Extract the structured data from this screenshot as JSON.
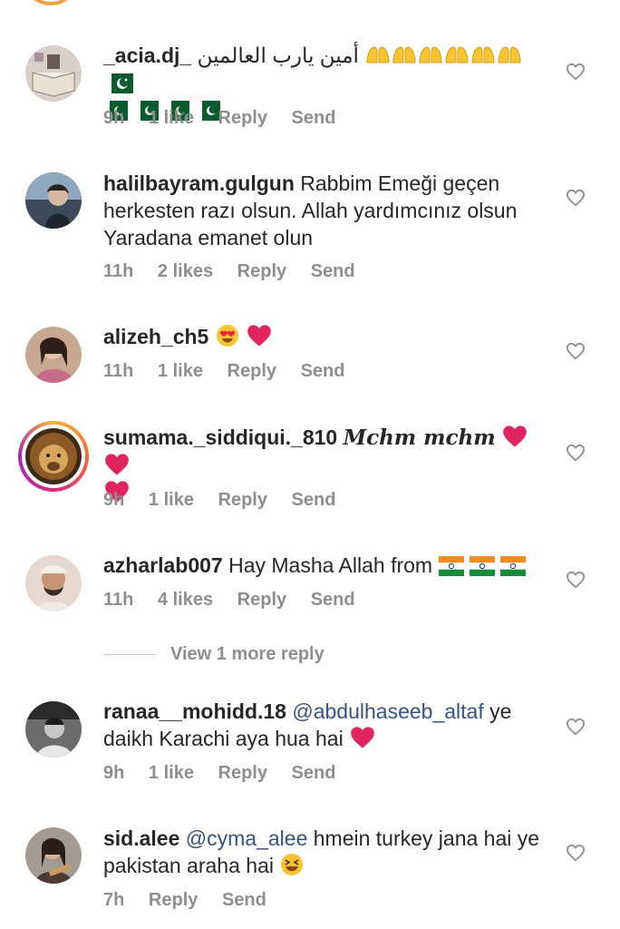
{
  "comments": [
    {
      "username": "_acia.dj_",
      "text": "أمين يارب العالمين",
      "time": "9h",
      "likes": "1 like",
      "reply": "Reply",
      "send": "Send"
    },
    {
      "username": "halilbayram.gulgun",
      "text": "Rabbim Emeği geçen herkesten razı olsun. Allah yardımcınız olsun Yaradana emanet olun",
      "time": "11h",
      "likes": "2 likes",
      "reply": "Reply",
      "send": "Send"
    },
    {
      "username": "alizeh_ch5",
      "text": "",
      "time": "11h",
      "likes": "1 like",
      "reply": "Reply",
      "send": "Send"
    },
    {
      "username": "sumama._siddiqui._810",
      "text": "Mchm mchm",
      "time": "9h",
      "likes": "1 like",
      "reply": "Reply",
      "send": "Send"
    },
    {
      "username": "azharlab007",
      "text": "Hay Masha Allah from",
      "time": "11h",
      "likes": "4 likes",
      "reply": "Reply",
      "send": "Send"
    },
    {
      "username": "ranaa__mohidd.18",
      "mention": "@abdulhaseeb_altaf",
      "text": "ye daikh Karachi aya hua hai",
      "time": "9h",
      "likes": "1 like",
      "reply": "Reply",
      "send": "Send"
    },
    {
      "username": "sid.alee",
      "mention": "@cyma_alee",
      "text": "hmein turkey jana hai ye pakistan araha hai",
      "time": "7h",
      "reply": "Reply",
      "send": "Send"
    }
  ],
  "view_more": "View 1 more reply",
  "icons": {
    "like": "heart-outline-icon",
    "heart_emoji": "red-heart-emoji",
    "praying": "open-hands-emoji",
    "flag_pk": "pakistan-flag-emoji",
    "flag_in": "india-flag-emoji",
    "heart_eyes": "heart-eyes-emoji",
    "laughing": "laughing-emoji"
  },
  "colors": {
    "text": "#262626",
    "meta": "#8e8e8e",
    "mention": "#385185",
    "heart": "#e0245e"
  }
}
